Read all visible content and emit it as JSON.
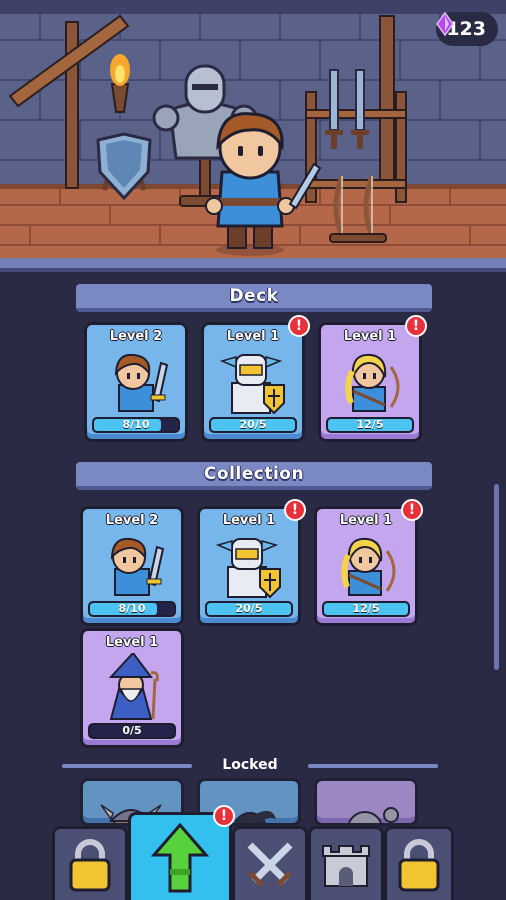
{
  "header": {
    "gems": "123"
  },
  "deck": {
    "title": "Deck",
    "cards": [
      {
        "level": "Level 2",
        "progress": "8/10",
        "ratio": 0.8,
        "style": "blue",
        "alert": false,
        "hero": "knight-hero"
      },
      {
        "level": "Level 1",
        "progress": "20/5",
        "ratio": 1.0,
        "style": "blue",
        "alert": true,
        "hero": "paladin-hero"
      },
      {
        "level": "Level 1",
        "progress": "12/5",
        "ratio": 1.0,
        "style": "purple",
        "alert": true,
        "hero": "archer-hero"
      }
    ]
  },
  "collection": {
    "title": "Collection",
    "cards": [
      {
        "level": "Level 2",
        "progress": "8/10",
        "ratio": 0.8,
        "style": "blue",
        "alert": false,
        "hero": "knight-hero"
      },
      {
        "level": "Level 1",
        "progress": "20/5",
        "ratio": 1.0,
        "style": "blue",
        "alert": true,
        "hero": "paladin-hero"
      },
      {
        "level": "Level 1",
        "progress": "12/5",
        "ratio": 1.0,
        "style": "purple",
        "alert": true,
        "hero": "archer-hero"
      },
      {
        "level": "Level 1",
        "progress": "0/5",
        "ratio": 0.0,
        "style": "purple",
        "alert": false,
        "hero": "wizard-hero"
      }
    ]
  },
  "locked": {
    "title": "Locked",
    "cards": [
      "viking-hero",
      "ninja-hero",
      "monk-hero"
    ]
  },
  "alert_mark": "!",
  "nav": {
    "items": [
      {
        "name": "nav-locked-left",
        "icon": "padlock-icon",
        "active": false
      },
      {
        "name": "nav-upgrade",
        "icon": "up-arrow-icon",
        "active": true,
        "alert": true
      },
      {
        "name": "nav-battle",
        "icon": "crossed-swords-icon",
        "active": false
      },
      {
        "name": "nav-castle",
        "icon": "castle-icon",
        "active": false
      },
      {
        "name": "nav-locked-right",
        "icon": "padlock-icon",
        "active": false
      }
    ]
  },
  "colors": {
    "card_blue": "#76b6ea",
    "card_purple": "#c3a6ee",
    "progress_fill": "#4cc3f0",
    "alert": "#e8303a",
    "active_tab": "#34c0ee",
    "background": "#2b2a45"
  }
}
